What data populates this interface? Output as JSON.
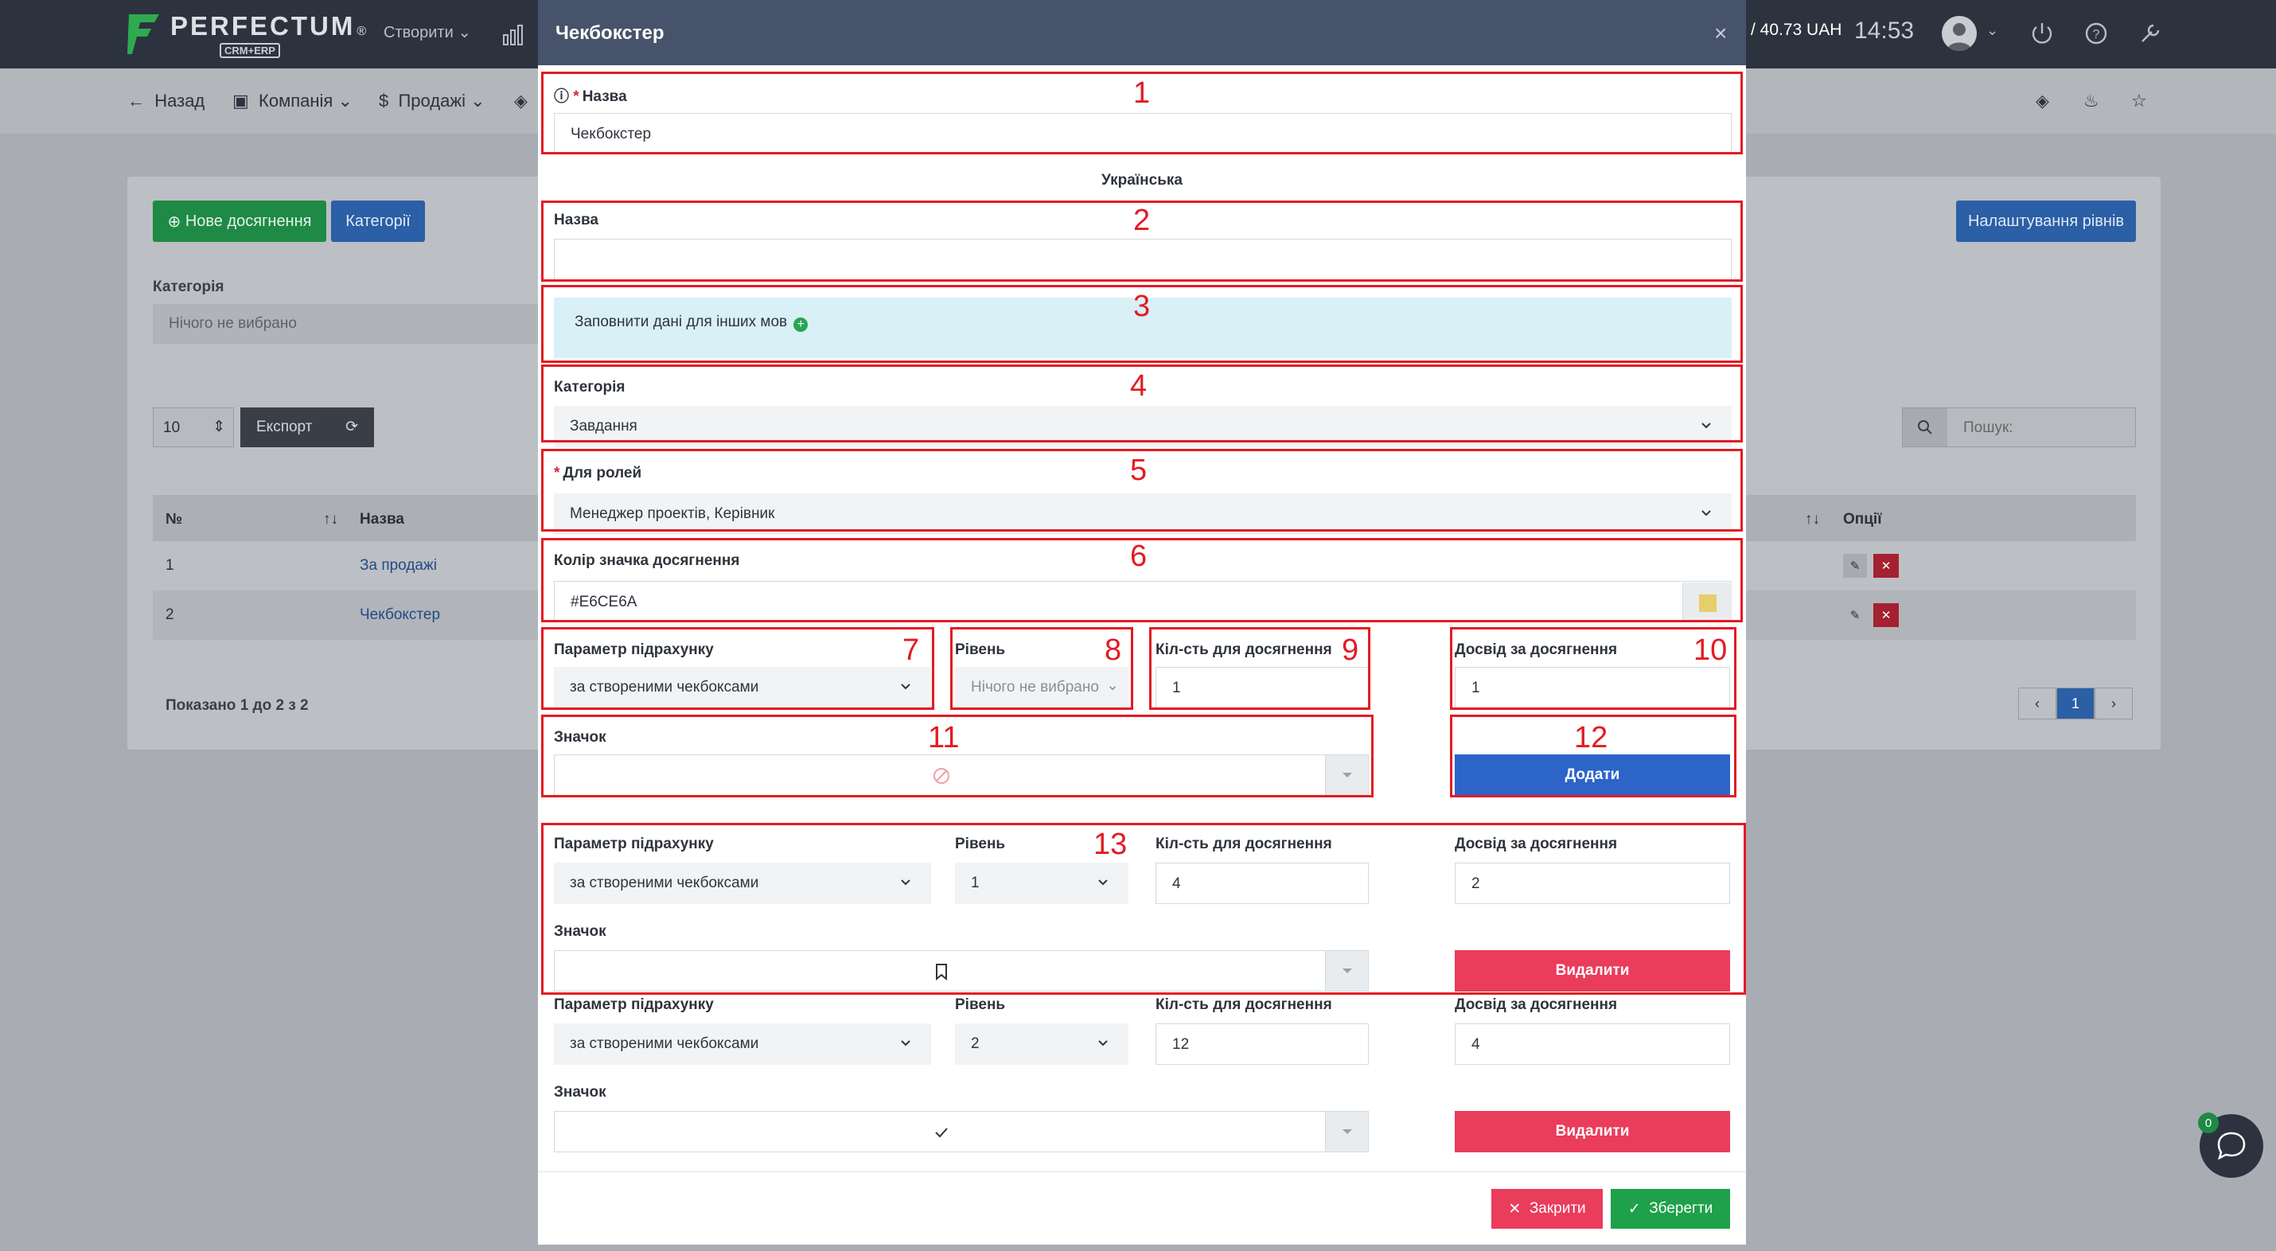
{
  "topbar": {
    "logo_word": "PERFECTUM",
    "logo_sub": "CRM+ERP",
    "logo_reg": "®",
    "create_label": "Створити",
    "balance": "/ 40.73 UAH",
    "time": "14:53"
  },
  "subnav": {
    "back": "Назад",
    "company": "Компанія",
    "sales": "Продажі"
  },
  "page": {
    "new_achievement": "Нове досягнення",
    "categories_btn": "Категорії",
    "levels_btn": "Налаштування рівнів",
    "category_label": "Категорія",
    "category_value": "Нічого не вибрано",
    "per_page": "10",
    "export": "Експорт",
    "search_placeholder": "Пошук:",
    "table_headers": [
      "№",
      "Назва",
      "Опції"
    ],
    "rows": [
      {
        "num": "1",
        "name": "За продажі"
      },
      {
        "num": "2",
        "name": "Чекбокстер"
      }
    ],
    "shown": "Показано 1 до 2 з 2",
    "page_num": "1"
  },
  "chat": {
    "badge": "0"
  },
  "modal": {
    "title": "Чекбокстер",
    "name_label": "Назва",
    "name_value": "Чекбокстер",
    "language": "Українська",
    "name_uk_label": "Назва",
    "name_uk_value": "",
    "other_langs": "Заповнити дані для інших мов",
    "category_label": "Категорія",
    "category_value": "Завдання",
    "roles_label": "Для ролей",
    "roles_value": "Менеджер проектів, Керівник",
    "color_label": "Колір значка досягнення",
    "color_value": "#E6CE6A",
    "new_level": {
      "param_label": "Параметр підрахунку",
      "param_value": "за створеними чекбоксами",
      "level_label": "Рівень",
      "level_value": "Нічого не вибрано",
      "count_label": "Кіл-сть для досягнення",
      "count_value": "1",
      "xp_label": "Досвід за досягнення",
      "xp_value": "1",
      "icon_label": "Значок",
      "add_btn": "Додати"
    },
    "levels": [
      {
        "param_label": "Параметр підрахунку",
        "param_value": "за створеними чекбоксами",
        "level_label": "Рівень",
        "level_value": "1",
        "count_label": "Кіл-сть для досягнення",
        "count_value": "4",
        "xp_label": "Досвід за досягнення",
        "xp_value": "2",
        "icon_label": "Значок",
        "icon": "bookmark-icon",
        "delete_btn": "Видалити"
      },
      {
        "param_label": "Параметр підрахунку",
        "param_value": "за створеними чекбоксами",
        "level_label": "Рівень",
        "level_value": "2",
        "count_label": "Кіл-сть для досягнення",
        "count_value": "12",
        "xp_label": "Досвід за досягнення",
        "xp_value": "4",
        "icon_label": "Значок",
        "icon": "check-icon",
        "delete_btn": "Видалити"
      }
    ],
    "close_btn": "Закрити",
    "save_btn": "Зберегти",
    "annotations": [
      "1",
      "2",
      "3",
      "4",
      "5",
      "6",
      "7",
      "8",
      "9",
      "10",
      "11",
      "12",
      "13"
    ]
  },
  "colors": {
    "accent_red": "#e31b23",
    "primary_blue": "#2c64c8",
    "danger": "#ea3c5b",
    "success": "#1fa04a",
    "header": "#47536a"
  }
}
